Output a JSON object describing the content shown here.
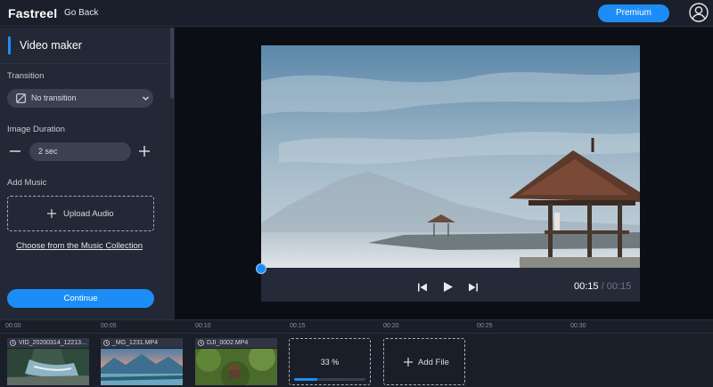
{
  "header": {
    "logo": "Fastreel",
    "go_back": "Go Back",
    "premium": "Premium",
    "avatar_icon": "user-circle-icon"
  },
  "sidebar": {
    "title": "Video maker",
    "transition": {
      "label": "Transition",
      "value": "No transition",
      "icon": "no-transition-icon"
    },
    "image_duration": {
      "label": "Image Duration",
      "value": "2 sec"
    },
    "add_music": {
      "label": "Add Music",
      "upload_label": "Upload Audio",
      "collection_link": "Choose from the Music Collection"
    },
    "continue_label": "Continue"
  },
  "player": {
    "current_time": "00:15",
    "separator": "/",
    "total_time": "00:15",
    "progress": 0.0
  },
  "timeline": {
    "ticks": [
      "00:00",
      "00:05",
      "00:10",
      "00:15",
      "00:20",
      "00:25",
      "00:30"
    ],
    "clips": [
      {
        "name": "VID_20200314_12213..."
      },
      {
        "name": "_MG_1231.MP4"
      },
      {
        "name": "DJI_0002.MP4"
      }
    ],
    "processing": {
      "percent_label": "33 %",
      "fraction": 0.33
    },
    "add_file_label": "Add File"
  },
  "colors": {
    "accent": "#1c8df7",
    "sidebar_bg": "#232836",
    "preview_bg": "#0b0e14"
  }
}
